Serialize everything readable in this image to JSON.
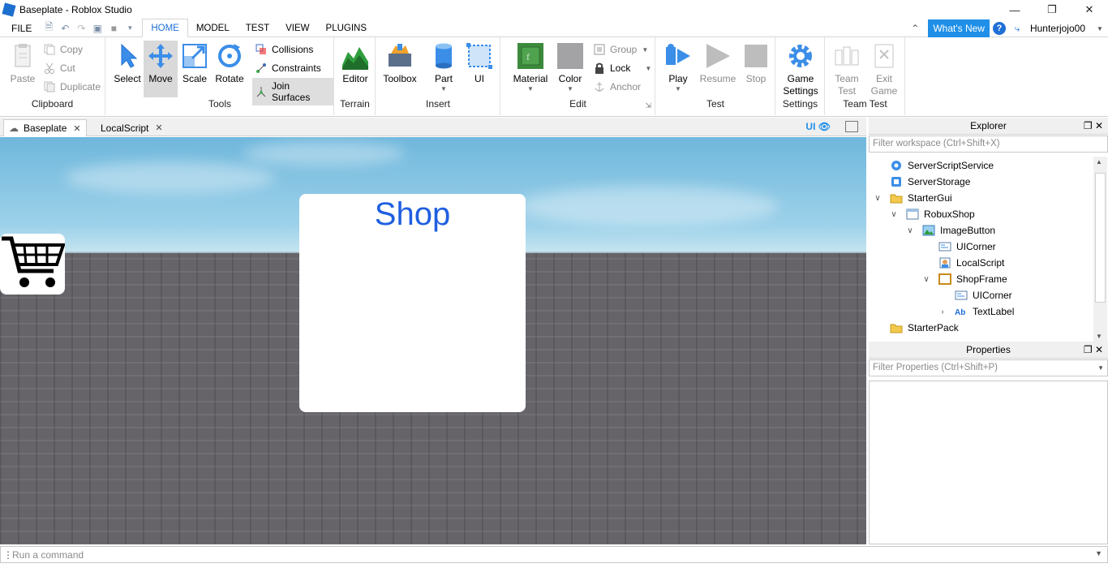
{
  "window": {
    "title": "Baseplate - Roblox Studio",
    "controls": [
      "minimize",
      "restore",
      "close"
    ]
  },
  "menu": {
    "file": "FILE",
    "tabs": [
      "HOME",
      "MODEL",
      "TEST",
      "VIEW",
      "PLUGINS"
    ],
    "active_tab": "HOME",
    "whats_new": "What's New",
    "username": "Hunterjojo00"
  },
  "ribbon": {
    "clipboard": {
      "label": "Clipboard",
      "paste": "Paste",
      "copy": "Copy",
      "cut": "Cut",
      "duplicate": "Duplicate"
    },
    "tools": {
      "label": "Tools",
      "select": "Select",
      "move": "Move",
      "scale": "Scale",
      "rotate": "Rotate",
      "collisions": "Collisions",
      "constraints": "Constraints",
      "join_surfaces": "Join Surfaces"
    },
    "terrain": {
      "label": "Terrain",
      "editor": "Editor"
    },
    "insert": {
      "label": "Insert",
      "toolbox": "Toolbox",
      "part": "Part",
      "ui": "UI"
    },
    "edit": {
      "label": "Edit",
      "material": "Material",
      "color": "Color",
      "group": "Group",
      "lock": "Lock",
      "anchor": "Anchor"
    },
    "test": {
      "label": "Test",
      "play": "Play",
      "resume": "Resume",
      "stop": "Stop"
    },
    "settings": {
      "label": "Settings",
      "game_settings_1": "Game",
      "game_settings_2": "Settings"
    },
    "team_test": {
      "label": "Team Test",
      "team_1": "Team",
      "team_2": "Test",
      "exit_1": "Exit",
      "exit_2": "Game"
    }
  },
  "doc_tabs": [
    {
      "label": "Baseplate",
      "active": true
    },
    {
      "label": "LocalScript",
      "active": false
    }
  ],
  "viewport_toolbar": {
    "ui_toggle": "UI"
  },
  "viewport": {
    "shop_title": "Shop",
    "shop_title_color": "#1f5fe0"
  },
  "explorer": {
    "title": "Explorer",
    "filter_placeholder": "Filter workspace (Ctrl+Shift+X)",
    "items": [
      {
        "label": "ServerScriptService",
        "icon": "server-script-service-icon",
        "depth": 0,
        "expander": ""
      },
      {
        "label": "ServerStorage",
        "icon": "server-storage-icon",
        "depth": 0,
        "expander": ""
      },
      {
        "label": "StarterGui",
        "icon": "folder-icon",
        "depth": 0,
        "expander": "expanded"
      },
      {
        "label": "RobuxShop",
        "icon": "screen-gui-icon",
        "depth": 1,
        "expander": "expanded"
      },
      {
        "label": "ImageButton",
        "icon": "image-button-icon",
        "depth": 2,
        "expander": "expanded"
      },
      {
        "label": "UICorner",
        "icon": "ui-corner-icon",
        "depth": 3,
        "expander": ""
      },
      {
        "label": "LocalScript",
        "icon": "local-script-icon",
        "depth": 3,
        "expander": ""
      },
      {
        "label": "ShopFrame",
        "icon": "frame-icon",
        "depth": 3,
        "expander": "expanded"
      },
      {
        "label": "UICorner",
        "icon": "ui-corner-icon",
        "depth": 4,
        "expander": ""
      },
      {
        "label": "TextLabel",
        "icon": "text-label-icon",
        "depth": 4,
        "expander": "collapsed"
      },
      {
        "label": "StarterPack",
        "icon": "folder-icon",
        "depth": 0,
        "expander": ""
      }
    ]
  },
  "properties": {
    "title": "Properties",
    "filter_placeholder": "Filter Properties (Ctrl+Shift+P)"
  },
  "command_bar": {
    "placeholder": "Run a command"
  }
}
